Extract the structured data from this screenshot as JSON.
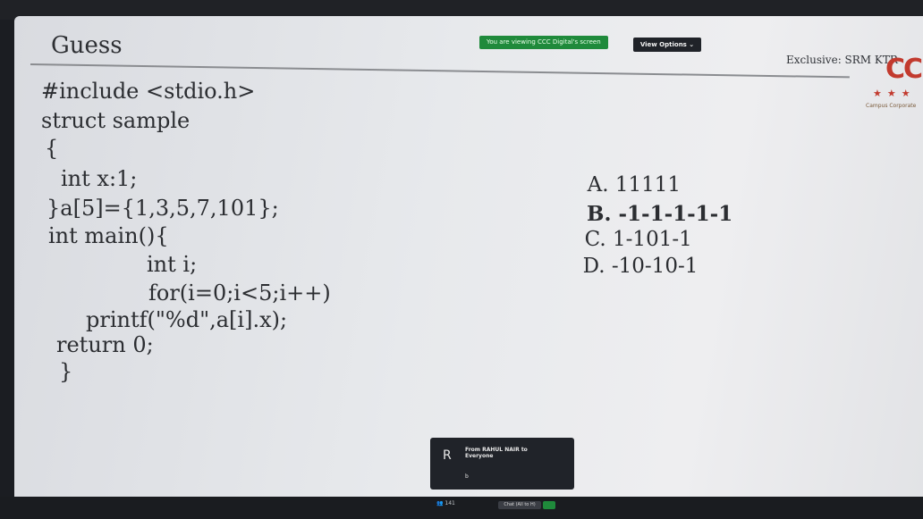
{
  "title": "Guess",
  "banner": "You are viewing CCC Digital's screen",
  "view_options": "View Options ⌄",
  "exclusive": "Exclusive: SRM KTR",
  "logo": {
    "letters": "CC",
    "stars": "★★★",
    "sub": "Campus Corporate"
  },
  "code_lines": [
    "#include <stdio.h>",
    "struct sample",
    "{",
    "int x:1;",
    "}a[5]={1,3,5,7,101};",
    "int main(){",
    "int i;",
    "for(i=0;i<5;i++)",
    "printf(\"%d\",a[i].x);",
    "return 0;",
    "}"
  ],
  "options": [
    {
      "letter": "A.",
      "text": "11111",
      "bold": false
    },
    {
      "letter": "B.",
      "text": "-1-1-1-1-1",
      "bold": true
    },
    {
      "letter": "C.",
      "text": "1-101-1",
      "bold": false
    },
    {
      "letter": "D.",
      "text": "-10-10-1",
      "bold": false
    }
  ],
  "chat_notification": {
    "avatar": "R",
    "from": "From RAHUL NAIR to",
    "to": "Everyone",
    "message": "b"
  },
  "taskbar": {
    "participants": "141",
    "chat": "Chat (All to H)"
  },
  "colors": {
    "banner_green": "#1f8a3b",
    "logo_red": "#c23a2e",
    "screen_bg": "#e7e9ec"
  }
}
